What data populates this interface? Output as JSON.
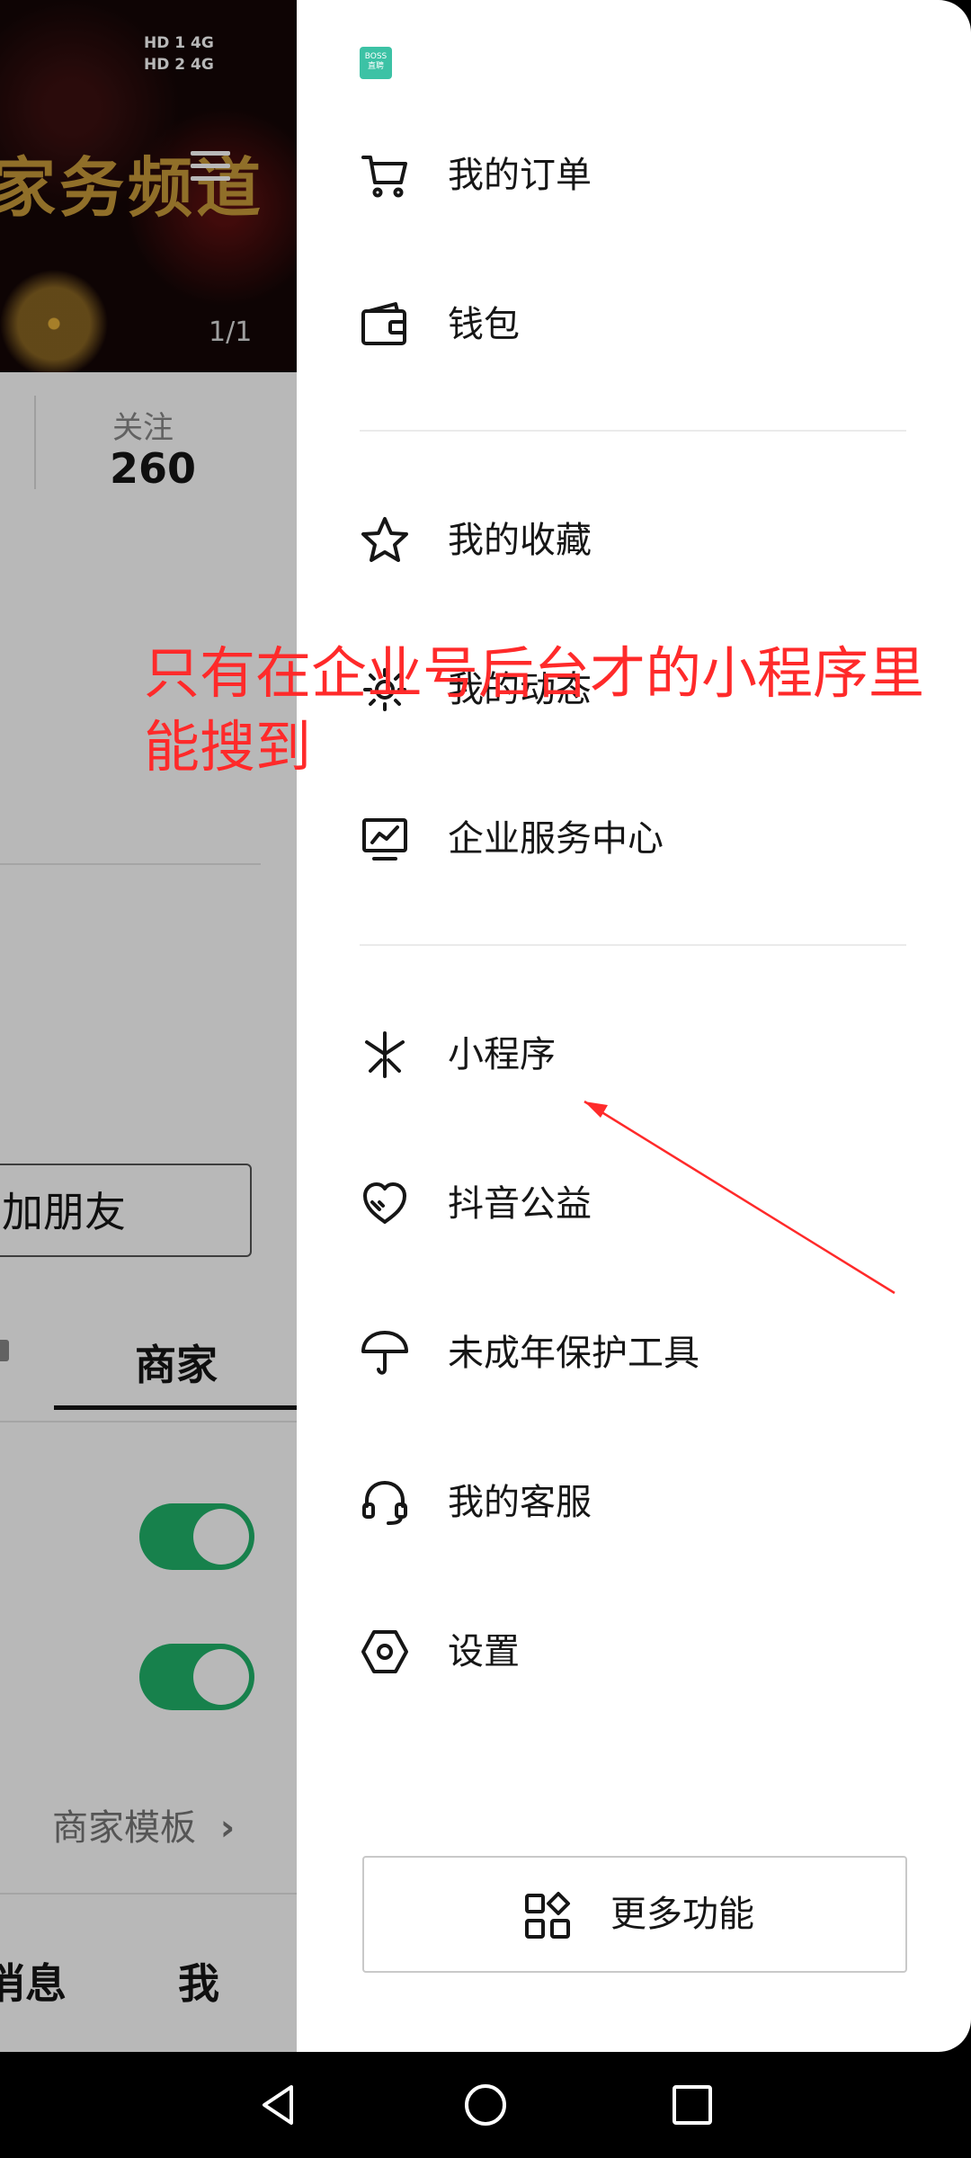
{
  "background_page": {
    "status_bar": {
      "sim1": "HD 1 4G",
      "sim2": "HD 2 4G"
    },
    "header_text": "家务频道",
    "image_counter": "1/1",
    "follow_label": "关注",
    "follow_count": "260",
    "add_friend_button": "加朋友",
    "tab_merchant": "商家",
    "toggle1_on": true,
    "toggle2_on": true,
    "template_link": "商家模板",
    "nav_message_partial": "消息",
    "nav_me": "我"
  },
  "drawer": {
    "logo_text": "BOSS直聘",
    "menu_items": [
      {
        "label": "我的订单",
        "icon": "cart-icon"
      },
      {
        "label": "钱包",
        "icon": "wallet-icon"
      },
      {
        "label": "我的收藏",
        "icon": "star-icon"
      },
      {
        "label": "我的动态",
        "icon": "moments-icon"
      },
      {
        "label": "企业服务中心",
        "icon": "enterprise-chart-icon"
      },
      {
        "label": "小程序",
        "icon": "mini-program-icon"
      },
      {
        "label": "抖音公益",
        "icon": "charity-heart-icon"
      },
      {
        "label": "未成年保护工具",
        "icon": "umbrella-icon"
      },
      {
        "label": "我的客服",
        "icon": "headset-icon"
      },
      {
        "label": "设置",
        "icon": "settings-hexagon-icon"
      }
    ],
    "more_button": {
      "label": "更多功能",
      "icon": "grid-apps-icon"
    }
  },
  "annotation": {
    "text": "只有在企业号后台才的小程序里能搜到",
    "color": "#ff2a2a"
  },
  "system_nav": [
    "back-icon",
    "home-icon",
    "recents-icon"
  ]
}
